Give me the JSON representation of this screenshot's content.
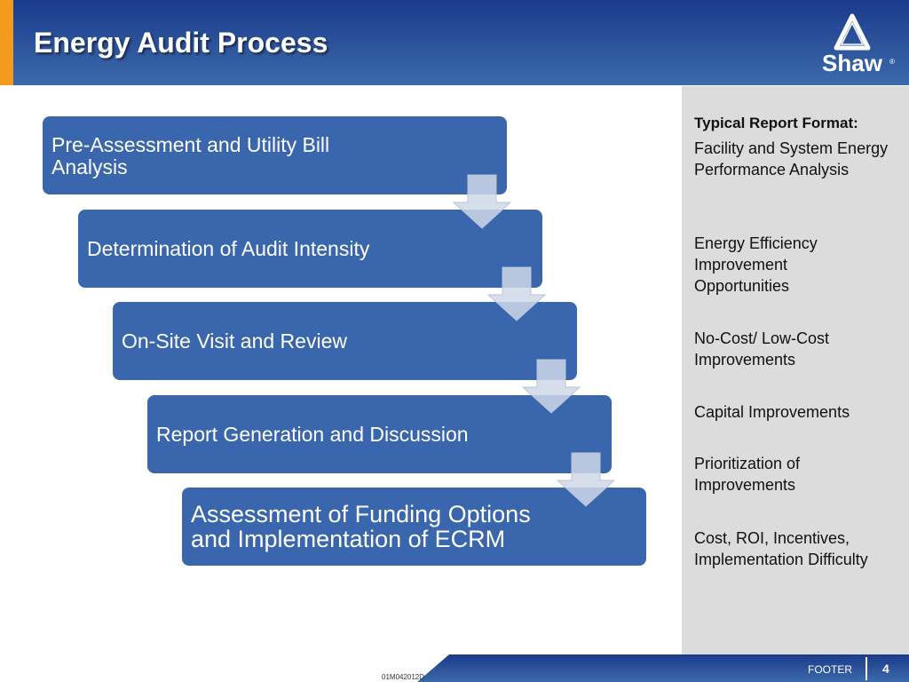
{
  "header": {
    "title": "Energy Audit Process",
    "logo_text": "Shaw"
  },
  "steps": [
    "Pre-Assessment and Utility Bill Analysis",
    "Determination of Audit Intensity",
    "On-Site Visit and Review",
    "Report Generation and Discussion",
    "Assessment of Funding Options and Implementation of ECRM"
  ],
  "panel": {
    "heading": "Typical Report Format:",
    "items": [
      "Facility and System Energy Performance Analysis",
      "Energy Efficiency Improvement Opportunities",
      "No-Cost/ Low-Cost Improvements",
      "Capital Improvements",
      "Prioritization of Improvements",
      "Cost, ROI, Incentives, Implementation Difficulty"
    ]
  },
  "footer": {
    "code": "01M042012D",
    "label": "FOOTER",
    "page": "4"
  }
}
